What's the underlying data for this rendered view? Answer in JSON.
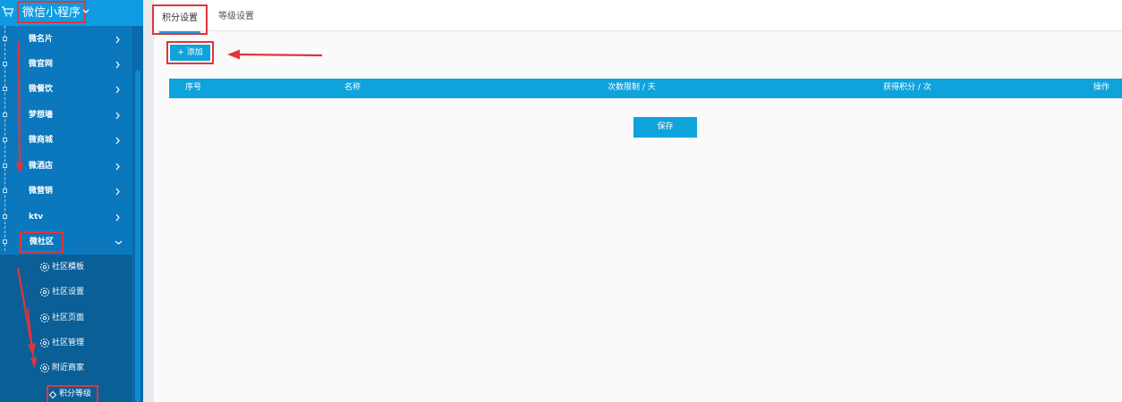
{
  "sidebar": {
    "title": "微信小程序",
    "items": [
      {
        "label": "微名片"
      },
      {
        "label": "微官网"
      },
      {
        "label": "微餐饮"
      },
      {
        "label": "梦想墙"
      },
      {
        "label": "微商城"
      },
      {
        "label": "微酒店"
      },
      {
        "label": "微营销"
      },
      {
        "label": "ktv"
      },
      {
        "label": "微社区"
      }
    ],
    "subitems": [
      {
        "label": "社区模板"
      },
      {
        "label": "社区设置"
      },
      {
        "label": "社区页面"
      },
      {
        "label": "社区管理"
      },
      {
        "label": "附近商家"
      }
    ],
    "subsub": {
      "label": "积分等级"
    }
  },
  "tabs": [
    {
      "label": "积分设置"
    },
    {
      "label": "等级设置"
    }
  ],
  "toolbar": {
    "add_label": "+ 添加"
  },
  "table": {
    "headers": [
      "序号",
      "名称",
      "次数限制 / 天",
      "获得积分 / 次",
      "操作"
    ]
  },
  "actions": {
    "save_label": "保存"
  },
  "colors": {
    "sidebar_bg": "#0b77bd",
    "accent": "#0fa3dc",
    "highlight": "#e0353b"
  }
}
